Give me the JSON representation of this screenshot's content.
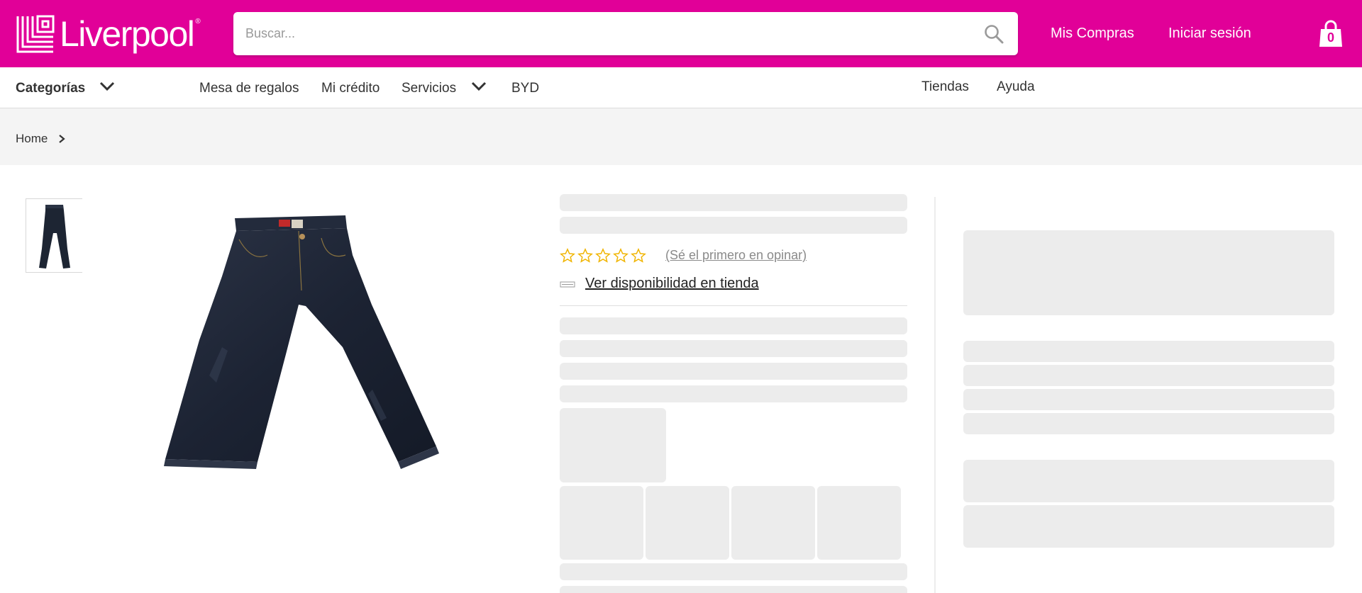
{
  "brand": {
    "name": "Liverpool",
    "reg": "®",
    "color": "#e10098"
  },
  "header": {
    "search_placeholder": "Buscar...",
    "links": {
      "mis_compras": "Mis Compras",
      "iniciar_sesion": "Iniciar sesión"
    },
    "cart_count": "0"
  },
  "nav": {
    "categorias": "Categorías",
    "mesa_de_regalos": "Mesa de regalos",
    "mi_credito": "Mi crédito",
    "servicios": "Servicios",
    "byd": "BYD",
    "tiendas": "Tiendas",
    "ayuda": "Ayuda"
  },
  "breadcrumb": {
    "home": "Home"
  },
  "product": {
    "rating_stars": 0,
    "rating_max": 5,
    "review_cta": "(Sé el primero en opinar)",
    "store_availability": "Ver disponibilidad en tienda"
  },
  "icons": [
    "logo-mark",
    "search-icon",
    "shopping-bag-icon",
    "chevron-down-icon",
    "chevron-right-icon",
    "star-outline-icon",
    "store-icon"
  ]
}
